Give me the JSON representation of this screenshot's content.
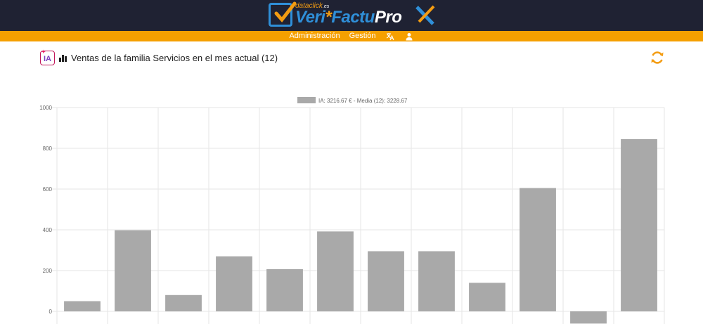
{
  "brand": {
    "small": "dataclick",
    "small_suffix": ".es",
    "name_a": "Veri",
    "name_b": "Factu",
    "name_c": "Pro"
  },
  "nav": {
    "items": [
      {
        "label": "Administración"
      },
      {
        "label": "Gestión"
      }
    ],
    "icons": [
      "translate-icon",
      "user-icon"
    ]
  },
  "header": {
    "badge": "IA",
    "title": "Ventas de la familia Servicios en el mes actual (12)",
    "icons": [
      "ia-badge-icon",
      "bar-chart-icon",
      "refresh-icon"
    ]
  },
  "colors": {
    "topbar": "#1f2233",
    "menubar": "#f5a000",
    "bar": "#a9a9a9",
    "accent": "#f39c12"
  },
  "chart_data": {
    "type": "bar",
    "legend": "IA: 3216.67 € - Media (12): 3228.67",
    "categories": [
      "",
      "",
      "",
      "",
      "",
      "",
      "",
      "",
      "",
      "",
      "",
      ""
    ],
    "values": [
      50,
      398,
      80,
      270,
      207,
      392,
      295,
      295,
      140,
      605,
      -60,
      845
    ],
    "ylim": [
      0,
      1000
    ],
    "yticks": [
      "1000",
      "800",
      "600",
      "400",
      "200",
      "0"
    ],
    "ytick_values": [
      1000,
      800,
      600,
      400,
      200,
      0
    ],
    "grid": true,
    "legend_position": "top"
  }
}
